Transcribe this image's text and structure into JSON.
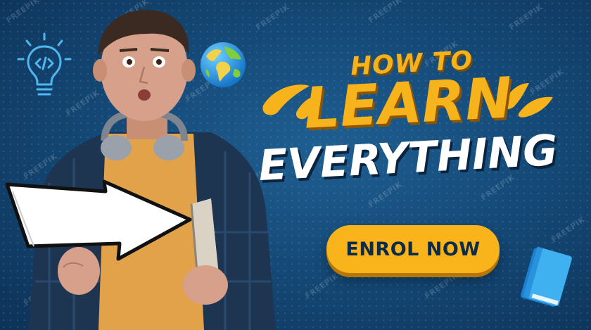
{
  "banner": {
    "headline": {
      "line1": "HOW TO",
      "line2": "LEARN",
      "line3": "EVERYTHING"
    },
    "cta_label": "ENROL NOW",
    "watermark": "FREEPIK"
  },
  "icons": {
    "bulb": "lightbulb-code-icon",
    "globe": "globe-icon",
    "book": "book-icon",
    "arrow": "arrow-sign"
  },
  "colors": {
    "background": "#154a78",
    "accent_yellow": "#f7b31b",
    "headline_white": "#ffffff",
    "button_text": "#0e2b48"
  }
}
